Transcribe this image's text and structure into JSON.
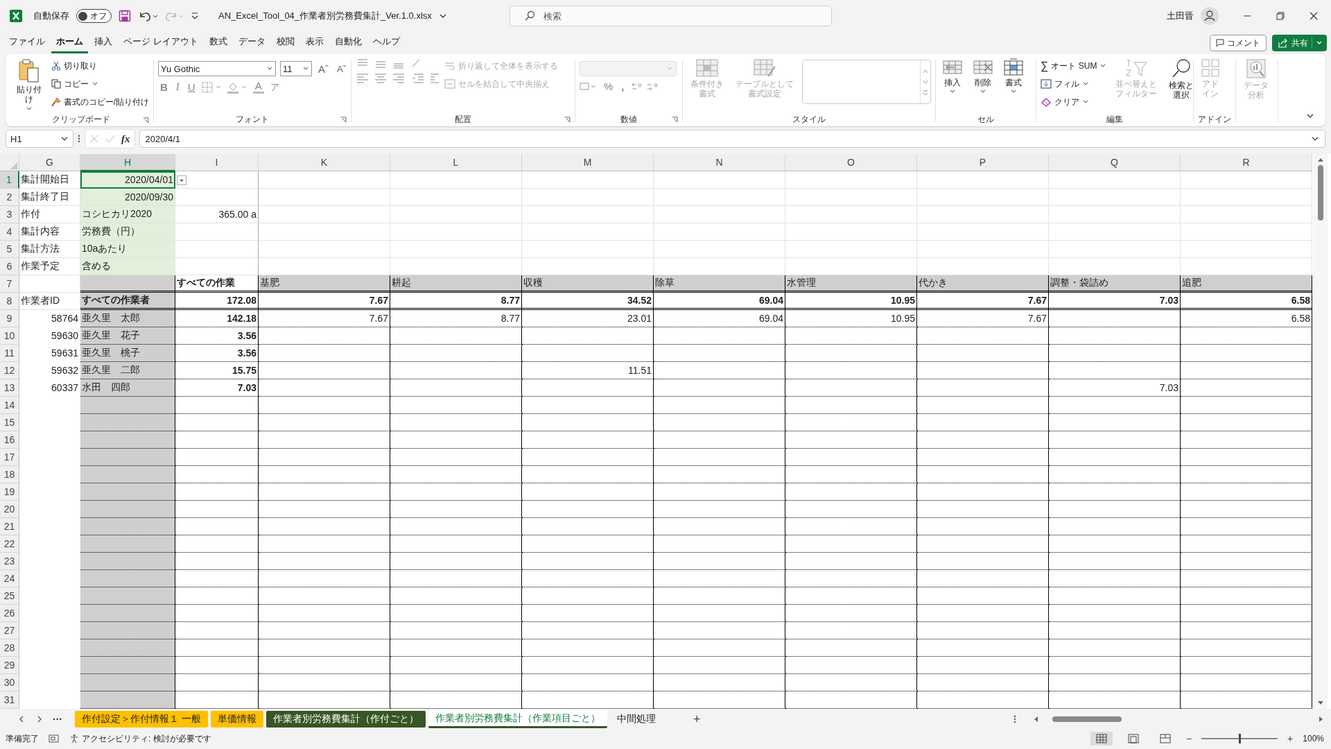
{
  "title_bar": {
    "autosave_label": "自動保存",
    "autosave": {
      "label": "オフ",
      "on": false
    },
    "filename": "AN_Excel_Tool_04_作業者別労務費集計_Ver.1.0.xlsx",
    "search_placeholder": "検索",
    "user": "土田晋"
  },
  "menu": [
    {
      "label": "ファイル",
      "selected": false
    },
    {
      "label": "ホーム",
      "selected": true
    },
    {
      "label": "挿入",
      "selected": false
    },
    {
      "label": "ページ レイアウト",
      "selected": false
    },
    {
      "label": "数式",
      "selected": false
    },
    {
      "label": "データ",
      "selected": false
    },
    {
      "label": "校閲",
      "selected": false
    },
    {
      "label": "表示",
      "selected": false
    },
    {
      "label": "自動化",
      "selected": false
    },
    {
      "label": "ヘルプ",
      "selected": false
    }
  ],
  "actions": {
    "comment": "コメント",
    "share": "共有"
  },
  "ribbon": {
    "clipboard": {
      "title": "クリップボード",
      "paste": "貼り付け",
      "cut": "切り取り",
      "copy": "コピー",
      "format_painter": "書式のコピー/貼り付け"
    },
    "font": {
      "title": "フォント",
      "name": "Yu Gothic",
      "size": "11",
      "grow": "Aˆ",
      "shrink": "Aˇ",
      "bold": "B",
      "italic": "I",
      "underline": "U",
      "font_color": "A",
      "phonetic": "ア"
    },
    "alignment": {
      "title": "配置",
      "wrap": {
        "label": "折り返して全体を表示する",
        "disabled": true
      },
      "merge": {
        "label": "セルを結合して中央揃え",
        "disabled": true
      }
    },
    "number": {
      "title": "数値",
      "percent": "%",
      "comma": ","
    },
    "styles": {
      "title": "スタイル",
      "buttons": [
        {
          "label": "条件付き書式",
          "kind": "conditional",
          "disabled": true
        },
        {
          "label": "テーブルとして書式設定",
          "kind": "table",
          "disabled": true
        }
      ]
    },
    "cells": {
      "title": "セル",
      "buttons": [
        {
          "label": "挿入",
          "kind": "insert"
        },
        {
          "label": "削除",
          "kind": "delete"
        },
        {
          "label": "書式",
          "kind": "format"
        }
      ]
    },
    "editing": {
      "title": "編集",
      "autosum_icon": "∑",
      "autosum": "オート SUM",
      "fill": "フィル",
      "clear": "クリア",
      "sort": {
        "label": "並べ替えとフィルター",
        "disabled": true
      },
      "find": {
        "label": "検索と選択",
        "disabled": false
      }
    },
    "addins": {
      "title": "アドイン",
      "buttons": [
        {
          "label": "アドイン",
          "kind": "addin",
          "disabled": true
        },
        {
          "label": "データ分析",
          "kind": "analysis",
          "disabled": true
        }
      ]
    }
  },
  "formula_bar": {
    "name_box": "H1",
    "fx": "fx",
    "formula": "2020/4/1"
  },
  "columns": [
    {
      "label": "G",
      "selected": false
    },
    {
      "label": "H",
      "selected": true
    },
    {
      "label": "I",
      "selected": false
    },
    {
      "label": "K",
      "selected": false
    },
    {
      "label": "L",
      "selected": false
    },
    {
      "label": "M",
      "selected": false
    },
    {
      "label": "N",
      "selected": false
    },
    {
      "label": "O",
      "selected": false
    },
    {
      "label": "P",
      "selected": false
    },
    {
      "label": "Q",
      "selected": false
    },
    {
      "label": "R",
      "selected": false
    }
  ],
  "rows": [
    {
      "row": "1",
      "selected": true,
      "kind": "setting_date",
      "cells": [
        "集計開始日",
        "2020/04/01",
        null,
        null,
        null,
        null,
        null,
        null,
        null,
        null,
        null
      ]
    },
    {
      "row": "2",
      "selected": false,
      "kind": "setting_date",
      "cells": [
        "集計終了日",
        "2020/09/30",
        null,
        null,
        null,
        null,
        null,
        null,
        null,
        null,
        null
      ]
    },
    {
      "row": "3",
      "selected": false,
      "kind": "setting_text",
      "cells": [
        "作付",
        "コシヒカリ2020",
        "365.00 a",
        null,
        null,
        null,
        null,
        null,
        null,
        null,
        null
      ]
    },
    {
      "row": "4",
      "selected": false,
      "kind": "setting_text",
      "cells": [
        "集計内容",
        "労務費（円）",
        null,
        null,
        null,
        null,
        null,
        null,
        null,
        null,
        null
      ]
    },
    {
      "row": "5",
      "selected": false,
      "kind": "setting_text",
      "cells": [
        "集計方法",
        "10aあたり",
        null,
        null,
        null,
        null,
        null,
        null,
        null,
        null,
        null
      ]
    },
    {
      "row": "6",
      "selected": false,
      "kind": "setting_text",
      "cells": [
        "作業予定",
        "含める",
        null,
        null,
        null,
        null,
        null,
        null,
        null,
        null,
        null
      ]
    },
    {
      "row": "7",
      "selected": false,
      "kind": "header",
      "cells": [
        null,
        null,
        "すべての作業",
        "基肥",
        "耕起",
        "収穫",
        "除草",
        "水管理",
        "代かき",
        "調整・袋詰め",
        "追肥"
      ]
    },
    {
      "row": "8",
      "selected": false,
      "kind": "total",
      "cells": [
        "作業者ID",
        "すべての作業者",
        "172.08",
        "7.67",
        "8.77",
        "34.52",
        "69.04",
        "10.95",
        "7.67",
        "7.03",
        "6.58"
      ]
    },
    {
      "row": "9",
      "selected": false,
      "kind": "worker",
      "cells": [
        "58764",
        "亜久里　太郎",
        "142.18",
        "7.67",
        "8.77",
        "23.01",
        "69.04",
        "10.95",
        "7.67",
        null,
        "6.58"
      ]
    },
    {
      "row": "10",
      "selected": false,
      "kind": "worker",
      "cells": [
        "59630",
        "亜久里　花子",
        "3.56",
        null,
        null,
        null,
        null,
        null,
        null,
        null,
        null
      ]
    },
    {
      "row": "11",
      "selected": false,
      "kind": "worker",
      "cells": [
        "59631",
        "亜久里　桃子",
        "3.56",
        null,
        null,
        null,
        null,
        null,
        null,
        null,
        null
      ]
    },
    {
      "row": "12",
      "selected": false,
      "kind": "worker",
      "cells": [
        "59632",
        "亜久里　二郎",
        "15.75",
        null,
        null,
        "11.51",
        null,
        null,
        null,
        null,
        null
      ]
    },
    {
      "row": "13",
      "selected": false,
      "kind": "worker",
      "cells": [
        "60337",
        "水田　四郎",
        "7.03",
        null,
        null,
        null,
        null,
        null,
        null,
        "7.03",
        null
      ]
    },
    {
      "row": "14",
      "selected": false,
      "kind": "empty"
    },
    {
      "row": "15",
      "selected": false,
      "kind": "empty"
    },
    {
      "row": "16",
      "selected": false,
      "kind": "empty"
    },
    {
      "row": "17",
      "selected": false,
      "kind": "empty"
    },
    {
      "row": "18",
      "selected": false,
      "kind": "empty"
    },
    {
      "row": "19",
      "selected": false,
      "kind": "empty"
    },
    {
      "row": "20",
      "selected": false,
      "kind": "empty"
    },
    {
      "row": "21",
      "selected": false,
      "kind": "empty"
    },
    {
      "row": "22",
      "selected": false,
      "kind": "empty"
    },
    {
      "row": "23",
      "selected": false,
      "kind": "empty"
    },
    {
      "row": "24",
      "selected": false,
      "kind": "empty"
    },
    {
      "row": "25",
      "selected": false,
      "kind": "empty"
    },
    {
      "row": "26",
      "selected": false,
      "kind": "empty"
    },
    {
      "row": "27",
      "selected": false,
      "kind": "empty"
    },
    {
      "row": "28",
      "selected": false,
      "kind": "empty"
    },
    {
      "row": "29",
      "selected": false,
      "kind": "empty"
    },
    {
      "row": "30",
      "selected": false,
      "kind": "empty"
    },
    {
      "row": "31",
      "selected": false,
      "kind": "empty"
    }
  ],
  "sheet_tabs": {
    "more": "···",
    "add": "+",
    "tabs": [
      {
        "label": "作付設定＞作付情報１ 一般",
        "color": "#ffc000",
        "selected": false
      },
      {
        "label": "単価情報",
        "color": "#ffc000",
        "selected": false
      },
      {
        "label": "作業者別労務費集計（作付ごと）",
        "color": "#375623",
        "selected": false
      },
      {
        "label": "作業者別労務費集計（作業項目ごと）",
        "color": "#375623",
        "selected": true
      },
      {
        "label": "中間処理",
        "selected": false
      }
    ]
  },
  "status_bar": {
    "ready": "準備完了",
    "accessibility": "アクセシビリティ: 検討が必要です",
    "views": [
      {
        "kind": "normal",
        "selected": true
      },
      {
        "kind": "page_layout",
        "selected": false
      },
      {
        "kind": "page_break",
        "selected": false
      }
    ],
    "zoom_out": "−",
    "zoom_in": "+",
    "zoom": {
      "label": "100%",
      "level": 0.5
    }
  }
}
